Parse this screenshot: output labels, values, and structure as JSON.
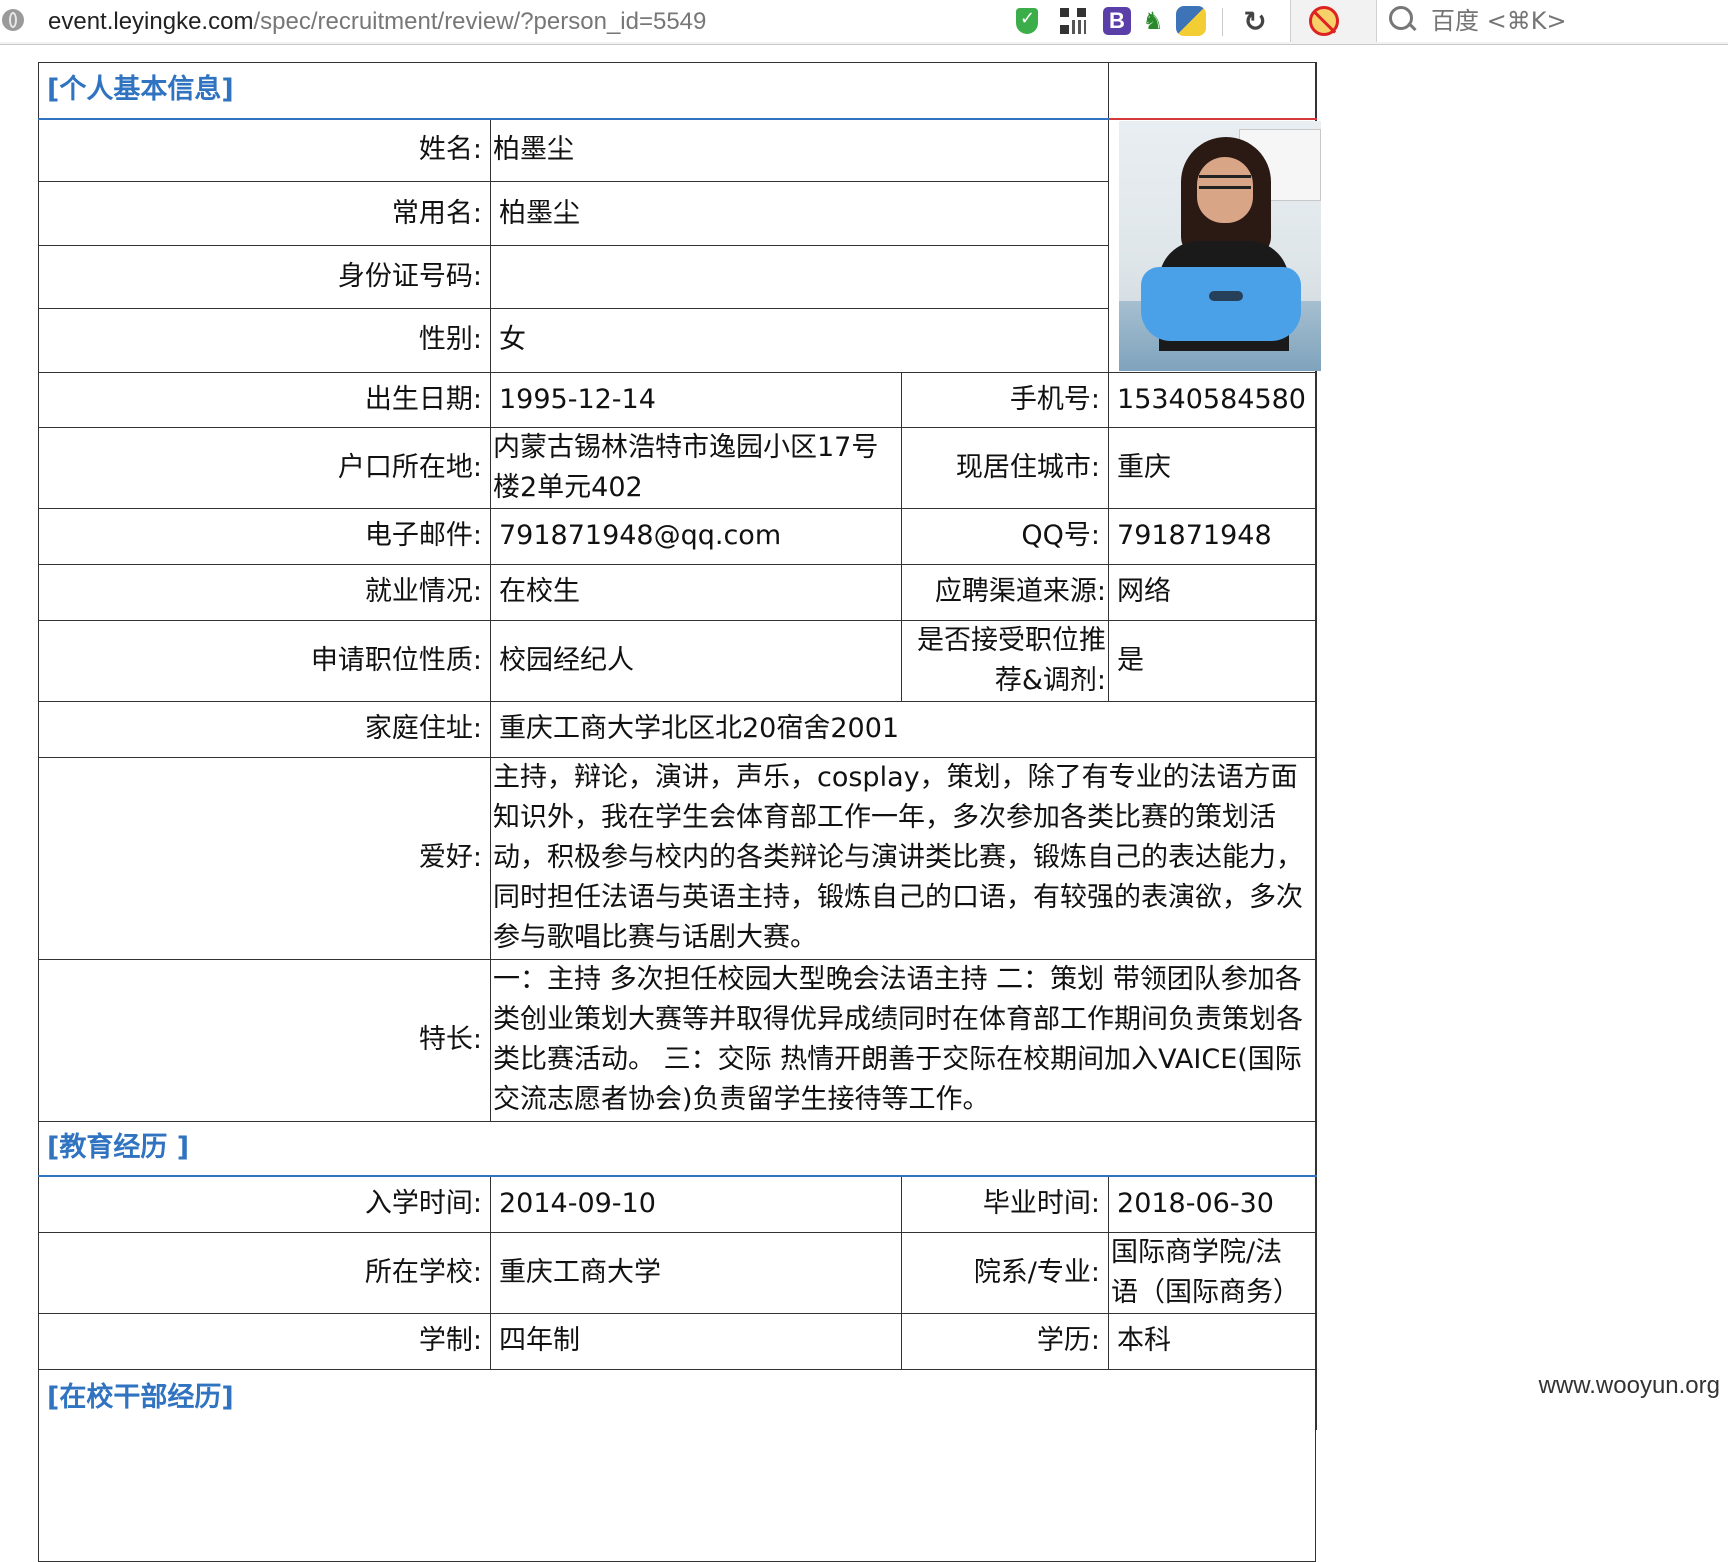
{
  "browser": {
    "url_host": "event.leyingke.com",
    "url_path": "/spec/recruitment/review/?person_id=5549",
    "search_placeholder": "百度 <⌘K>",
    "icons": [
      "globe-icon",
      "shield-icon",
      "qr-code-icon",
      "b-icon",
      "horse-icon",
      "python-icon",
      "reload-icon",
      "noscript-icon",
      "search-icon"
    ]
  },
  "sections": {
    "personal": "[个人基本信息]",
    "education": "[教育经历 ]",
    "cadre": "[在校干部经历]"
  },
  "personal": {
    "name_label": "姓名:",
    "name": "柏墨尘",
    "common_name_label": "常用名:",
    "common_name": "柏墨尘",
    "id_label": "身份证号码:",
    "id": "",
    "gender_label": "性别:",
    "gender": "女",
    "birth_label": "出生日期:",
    "birth": "1995-12-14",
    "phone_label": "手机号:",
    "phone": "15340584580",
    "hukou_label": "户口所在地:",
    "hukou": "内蒙古锡林浩特市逸园小区17号楼2单元402",
    "city_label": "现居住城市:",
    "city": "重庆",
    "email_label": "电子邮件:",
    "email": "791871948@qq.com",
    "qq_label": "QQ号:",
    "qq": "791871948",
    "employment_label": "就业情况:",
    "employment": "在校生",
    "channel_label": "应聘渠道来源:",
    "channel": "网络",
    "position_label": "申请职位性质:",
    "position": "校园经纪人",
    "accept_label": "是否接受职位推荐&调剂:",
    "accept": "是",
    "address_label": "家庭住址:",
    "address": "重庆工商大学北区北20宿舍2001",
    "hobby_label": "爱好:",
    "hobby": "主持，辩论，演讲，声乐，cosplay，策划，除了有专业的法语方面知识外，我在学生会体育部工作一年，多次参加各类比赛的策划活动，积极参与校内的各类辩论与演讲类比赛，锻炼自己的表达能力，同时担任法语与英语主持，锻炼自己的口语，有较强的表演欲，多次参与歌唱比赛与话剧大赛。",
    "skill_label": "特长:",
    "skill": "一：主持 多次担任校园大型晚会法语主持 二：策划 带领团队参加各类创业策划大赛等并取得优异成绩同时在体育部工作期间负责策划各类比赛活动。 三：交际 热情开朗善于交际在校期间加入VAICE(国际交流志愿者协会)负责留学生接待等工作。"
  },
  "education": {
    "enroll_label": "入学时间:",
    "enroll": "2014-09-10",
    "graduate_label": "毕业时间:",
    "graduate": "2018-06-30",
    "school_label": "所在学校:",
    "school": "重庆工商大学",
    "major_label": "院系/专业:",
    "major": "国际商学院/法语（国际商务）",
    "duration_label": "学制:",
    "duration": "四年制",
    "degree_label": "学历:",
    "degree": "本科"
  },
  "watermark": "www.wooyun.org"
}
